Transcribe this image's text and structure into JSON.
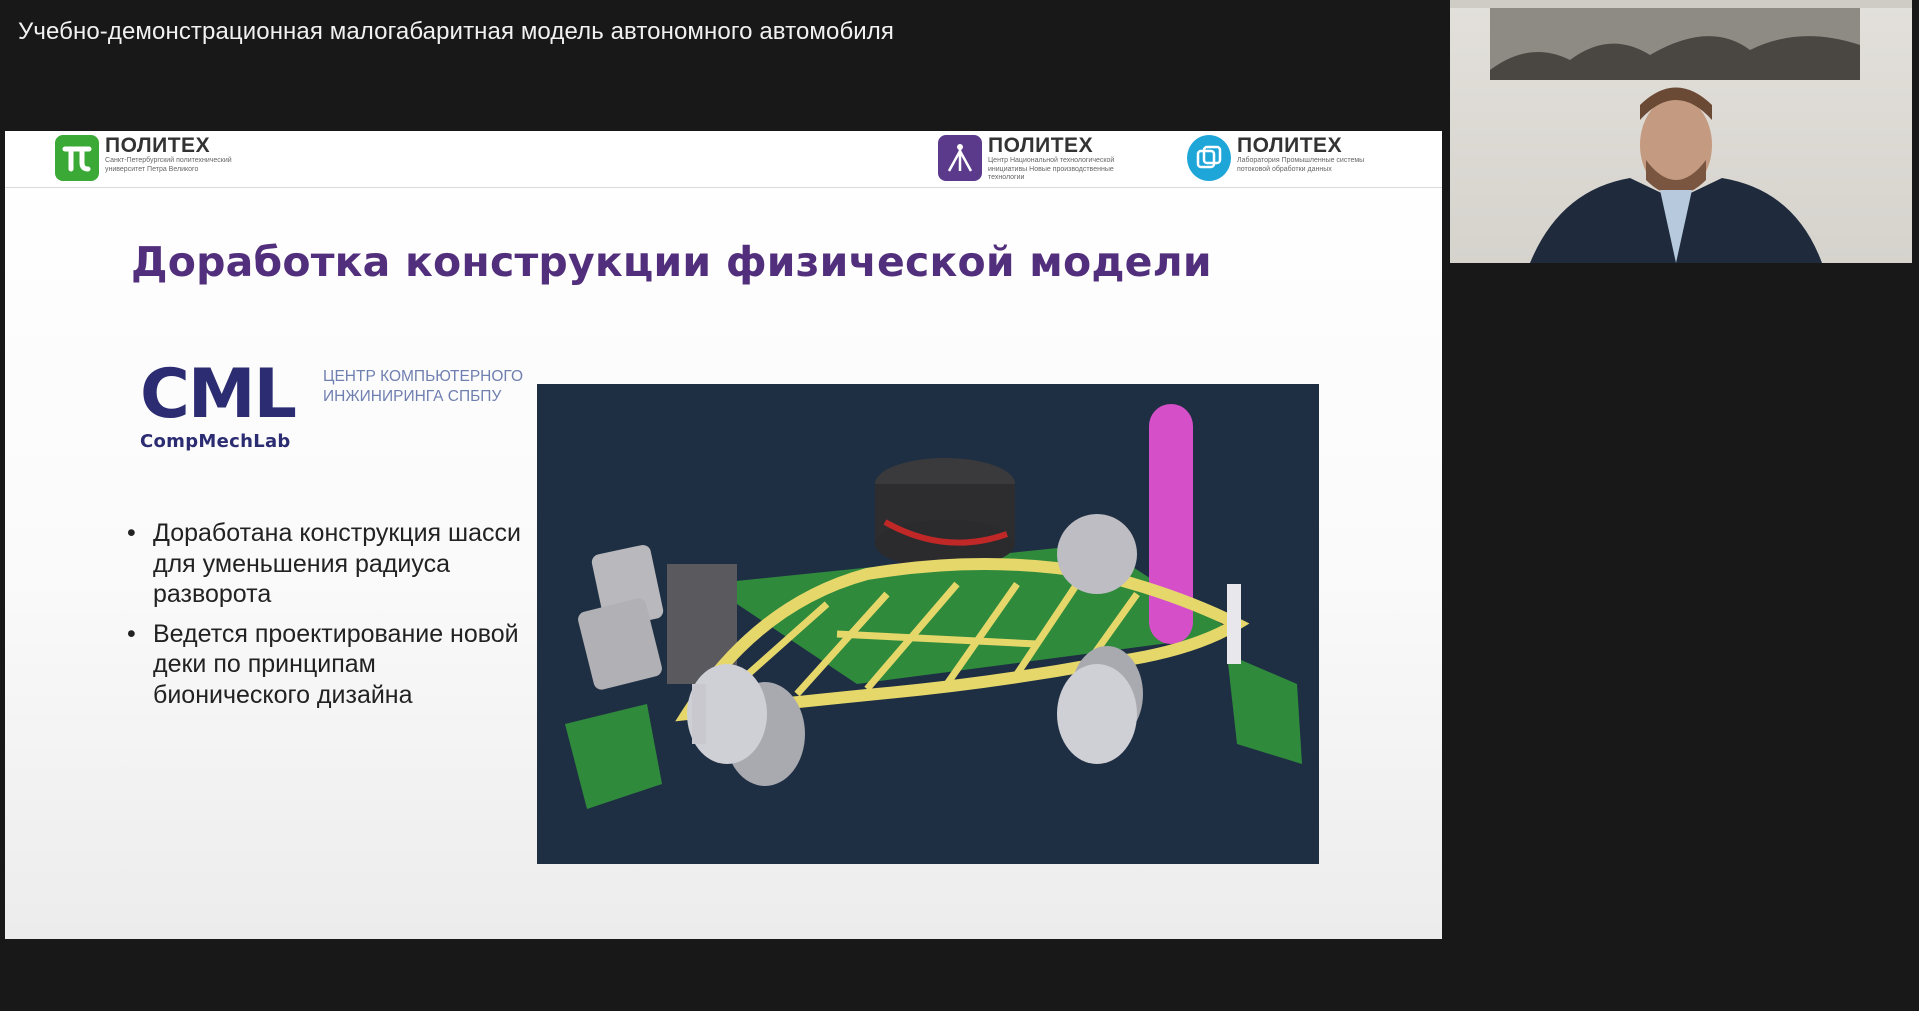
{
  "video": {
    "title": "Учебно-демонстрационная малогабаритная модель автономного автомобиля"
  },
  "slide": {
    "logos": [
      {
        "name": "ПОЛИТЕХ",
        "sub": "Санкт-Петербургский политехнический университет Петра Великого",
        "color": "#3aa935"
      },
      {
        "name": "ПОЛИТЕХ",
        "sub": "Центр Национальной технологической инициативы Новые производственные технологии",
        "color": "#5b3a8c"
      },
      {
        "name": "ПОЛИТЕХ",
        "sub": "Лаборатория Промышленные системы потоковой обработки данных",
        "color": "#1ea6d8"
      }
    ],
    "title": "Доработка конструкции физической модели",
    "cml": {
      "big": "CML",
      "small": "CompMechLab",
      "desc": "ЦЕНТР КОМПЬЮТЕРНОГО ИНЖИНИРИНГА СПбПУ"
    },
    "bullets": [
      "Доработана конструкция шасси для уменьшения радиуса разворота",
      "Ведется проектирование новой деки по принципам бионического дизайна"
    ]
  },
  "colors": {
    "title": "#522f7c",
    "cml": "#2c2c72",
    "render_bg": "#1f2f43",
    "frame": "#e6d76a",
    "pcb": "#2f8a3c",
    "stand": "#d44fc8"
  }
}
